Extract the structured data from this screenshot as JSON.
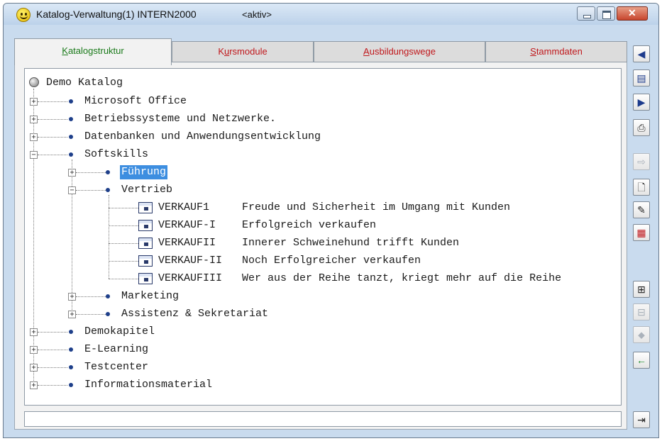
{
  "window": {
    "title": "Katalog-Verwaltung(1) INTERN2000",
    "status": "<aktiv>"
  },
  "tabs": [
    {
      "pre": "",
      "accel": "K",
      "post": "atalogstruktur"
    },
    {
      "pre": "K",
      "accel": "u",
      "post": "rsmodule"
    },
    {
      "pre": "",
      "accel": "A",
      "post": "usbildungswege"
    },
    {
      "pre": "",
      "accel": "S",
      "post": "tammdaten"
    }
  ],
  "tree": {
    "root": "Demo Katalog",
    "items": [
      {
        "label": "Microsoft Office",
        "expander": "+"
      },
      {
        "label": "Betriebssysteme und Netzwerke.",
        "expander": "+"
      },
      {
        "label": "Datenbanken und Anwendungsentwicklung",
        "expander": "+"
      },
      {
        "label": "Softskills",
        "expander": "−"
      },
      {
        "label": "Führung",
        "expander": "+"
      },
      {
        "label": "Vertrieb",
        "expander": "−"
      },
      {
        "code": "VERKAUF1",
        "title": "Freude und Sicherheit im Umgang mit Kunden"
      },
      {
        "code": "VERKAUF-I",
        "title": "Erfolgreich verkaufen"
      },
      {
        "code": "VERKAUFII",
        "title": "Innerer Schweinehund trifft Kunden"
      },
      {
        "code": "VERKAUF-II",
        "title": "Noch Erfolgreicher verkaufen"
      },
      {
        "code": "VERKAUFIII",
        "title": "Wer aus der Reihe tanzt, kriegt mehr auf die Reihe"
      },
      {
        "label": "Marketing",
        "expander": "+"
      },
      {
        "label": "Assistenz & Sekretariat",
        "expander": "+"
      },
      {
        "label": "Demokapitel",
        "expander": "+"
      },
      {
        "label": "E-Learning",
        "expander": "+"
      },
      {
        "label": "Testcenter",
        "expander": "+"
      },
      {
        "label": "Informationsmaterial",
        "expander": "+"
      }
    ]
  },
  "toolbar": {
    "glyphs": [
      "◀",
      "▤",
      "▶",
      "⎙",
      "⇨",
      "🗋",
      "✎",
      "▦",
      "⊞",
      "⊟",
      "⬥",
      "←",
      "⇥"
    ]
  },
  "colors": {
    "tab_active": "#1a7a1a",
    "tab_inactive": "#c0181c",
    "selection": "#3d8ee0",
    "bullet": "#1e3f8a"
  }
}
